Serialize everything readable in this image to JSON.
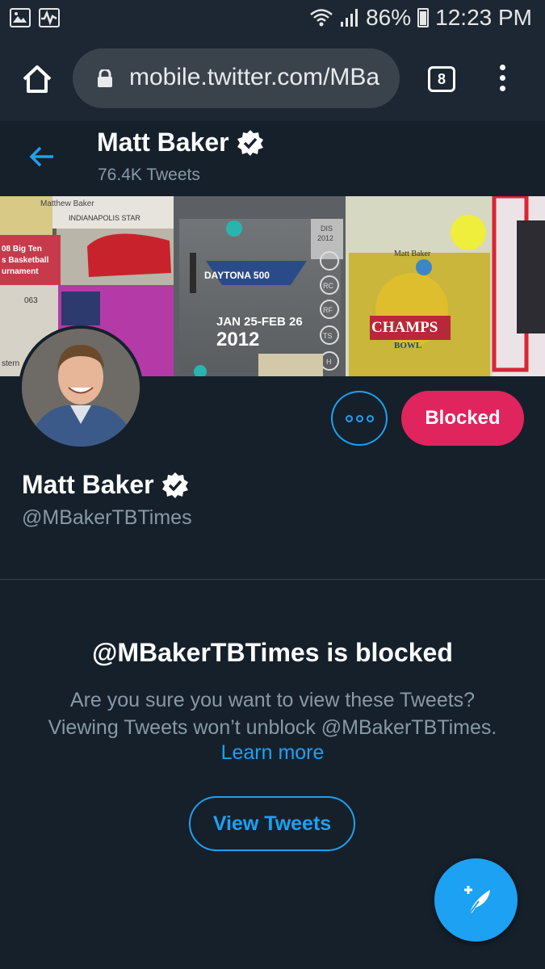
{
  "status_bar": {
    "battery": "86%",
    "time": "12:23 PM",
    "icons": [
      "gallery-icon",
      "activity-icon",
      "wifi-icon",
      "signal-icon",
      "battery-icon"
    ]
  },
  "browser": {
    "url": "mobile.twitter.com/MBa",
    "tab_count": "8",
    "icons": [
      "home-icon",
      "lock-icon",
      "tabs-icon",
      "more-vert-icon"
    ]
  },
  "header": {
    "name": "Matt Baker",
    "tweet_count": "76.4K Tweets"
  },
  "banner": {
    "texts": [
      "Matthew Baker",
      "INDIANAPOLIS STAR",
      "08 Big Ten",
      "s Basketball",
      "urnament",
      "063",
      "DAYTONA 500",
      "JAN 25-FEB 26",
      "2012",
      "DIS",
      "2012",
      "RC",
      "RF",
      "TS",
      "H",
      "Matt Baker",
      "CHAMPS",
      "BOWL",
      "stern"
    ]
  },
  "profile": {
    "name": "Matt Baker",
    "handle": "@MBakerTBTimes",
    "blocked_label": "Blocked"
  },
  "blocked_notice": {
    "title": "@MBakerTBTimes is blocked",
    "line1": "Are you sure you want to view these Tweets?",
    "line2": "Viewing Tweets won’t unblock @MBakerTBTimes.",
    "learn_more": "Learn more",
    "view_tweets": "View Tweets"
  },
  "colors": {
    "background": "#15202b",
    "accent": "#1da1f2",
    "blocked": "#e0245e",
    "muted": "#8899a6"
  }
}
